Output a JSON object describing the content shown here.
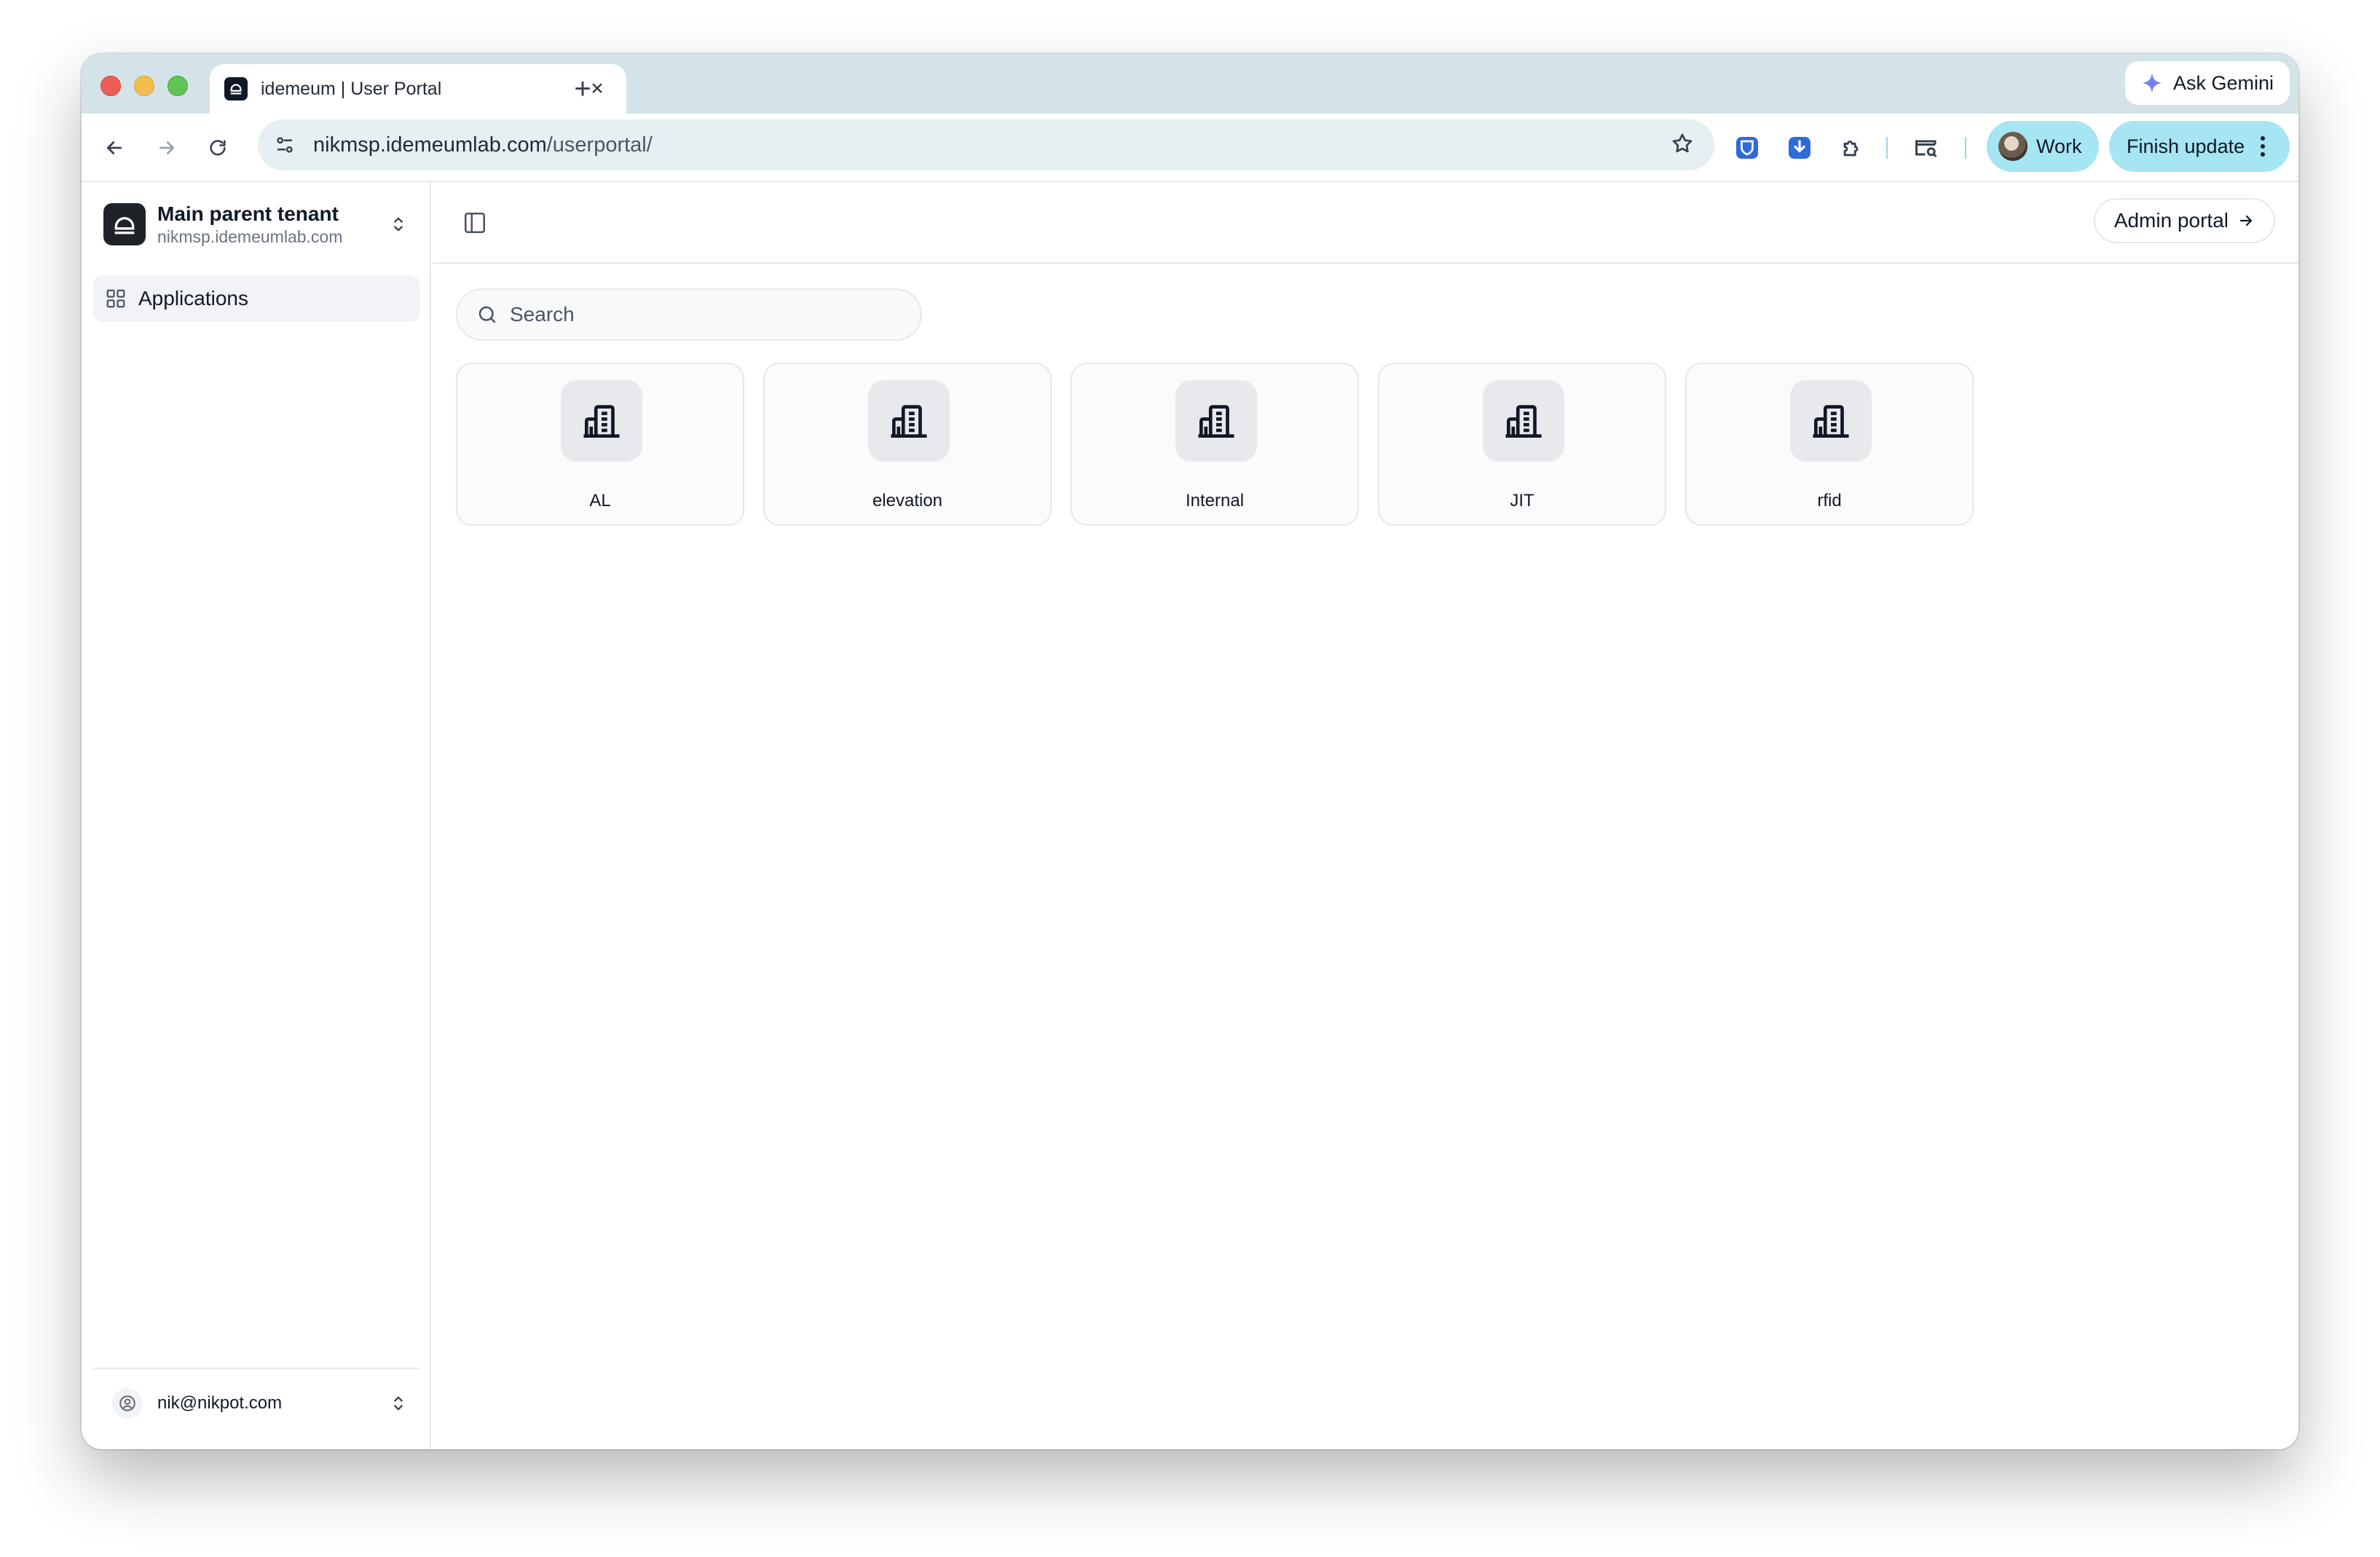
{
  "browser": {
    "tab_title": "idemeum | User Portal",
    "tab_close": "×",
    "new_tab": "+",
    "gemini_label": "Ask Gemini",
    "url_host": "nikmsp.idemeumlab.com",
    "url_path": "/userportal/",
    "profile_label": "Work",
    "update_label": "Finish update"
  },
  "sidebar": {
    "tenant_name": "Main parent tenant",
    "tenant_domain": "nikmsp.idemeumlab.com",
    "nav": [
      {
        "label": "Applications",
        "icon": "grid-icon",
        "active": true
      }
    ],
    "user_email": "nik@nikpot.com"
  },
  "topbar": {
    "admin_label": "Admin portal"
  },
  "main": {
    "search_placeholder": "Search",
    "apps": [
      {
        "label": "AL",
        "icon": "building-icon"
      },
      {
        "label": "elevation",
        "icon": "building-icon"
      },
      {
        "label": "Internal",
        "icon": "building-icon"
      },
      {
        "label": "JIT",
        "icon": "building-icon"
      },
      {
        "label": "rfid",
        "icon": "building-icon"
      }
    ]
  },
  "colors": {
    "tab_strip": "#d3e3e7",
    "chip_accent": "#a6e5f2",
    "extension_blue": "#2f6bd8"
  }
}
